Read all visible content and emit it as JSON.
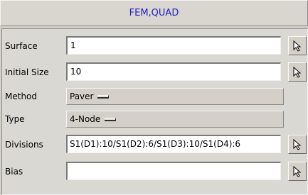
{
  "window": {
    "title": "FEM,QUAD"
  },
  "form": {
    "surface": {
      "label": "Surface",
      "value": "1"
    },
    "initial_size": {
      "label": "Initial Size",
      "value": "10"
    },
    "method": {
      "label": "Method",
      "value": "Paver"
    },
    "type": {
      "label": "Type",
      "value": "4-Node"
    },
    "divisions": {
      "label": "Divisions",
      "value": "S1(D1):10/S1(D2):6/S1(D3):10/S1(D4):6"
    },
    "bias": {
      "label": "Bias",
      "value": ""
    }
  },
  "icons": {
    "select": "arrow-cursor-icon",
    "option_indicator": "option-menu-indicator-icon"
  }
}
